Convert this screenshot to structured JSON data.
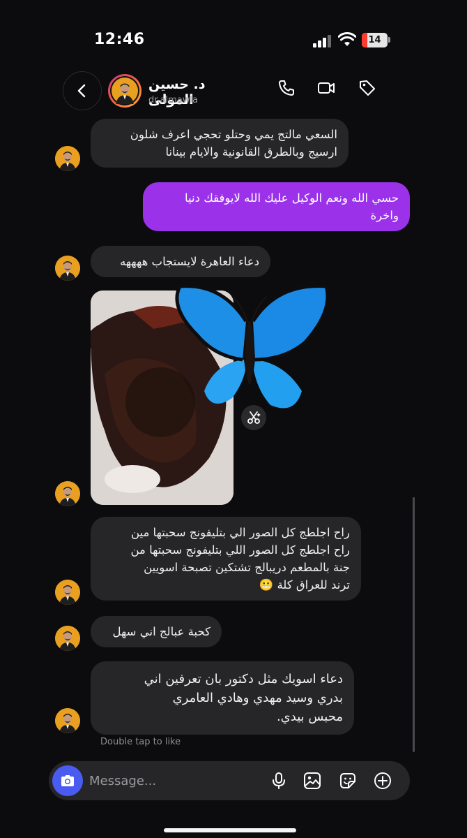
{
  "status_bar": {
    "time": "12:46",
    "battery": "14"
  },
  "header": {
    "name": "د. حسين المولى",
    "handle": "dr.almawla",
    "icons": [
      "back-icon",
      "phone-icon",
      "video-icon",
      "tag-icon"
    ]
  },
  "messages": [
    {
      "from": "them",
      "lines": [
        "السعي مالتج يمي وحتلو تحجي اعرف شلون",
        "ارسيج وبالطرق القانونية والايام بينانا"
      ]
    },
    {
      "from": "me",
      "lines": [
        "حسي الله ونعم الوكيل عليك الله لايوفقك دنيا",
        "واخرة"
      ]
    },
    {
      "from": "them",
      "lines": [
        "دعاء العاهرة لايستجاب  ههههه"
      ]
    },
    {
      "from": "them",
      "type": "image",
      "sticker": "butterfly"
    },
    {
      "from": "them",
      "lines": [
        "راح اجلطج كل الصور الي بتليفونج سحبتها مين",
        "راح اجلطج كل الصور اللي بتليفونج سحبتها من",
        "جنة بالمطعم دريبالج تشتكين تصبحة اسويين",
        "ترند للعراق كلة  😬"
      ]
    },
    {
      "from": "them",
      "lines": [
        "كحبة عبالج اني سهل"
      ]
    },
    {
      "from": "them",
      "lines": [
        "دعاء اسويك مثل دكتور بان تعرفين اني",
        "بدري وسيد مهدي وهادي العامري",
        "محبس بيدي."
      ]
    }
  ],
  "double_tap_hint": "Double tap to like",
  "composer": {
    "placeholder": "Message...",
    "icons": [
      "camera-icon",
      "microphone-icon",
      "gallery-icon",
      "sticker-icon",
      "add-icon"
    ]
  },
  "colors": {
    "background": "#0c0c0e",
    "received_bubble": "#262629",
    "sent_bubble": "#9b32ea",
    "camera_button": "#4a5cf0",
    "avatar_bg": "#e9a020"
  }
}
